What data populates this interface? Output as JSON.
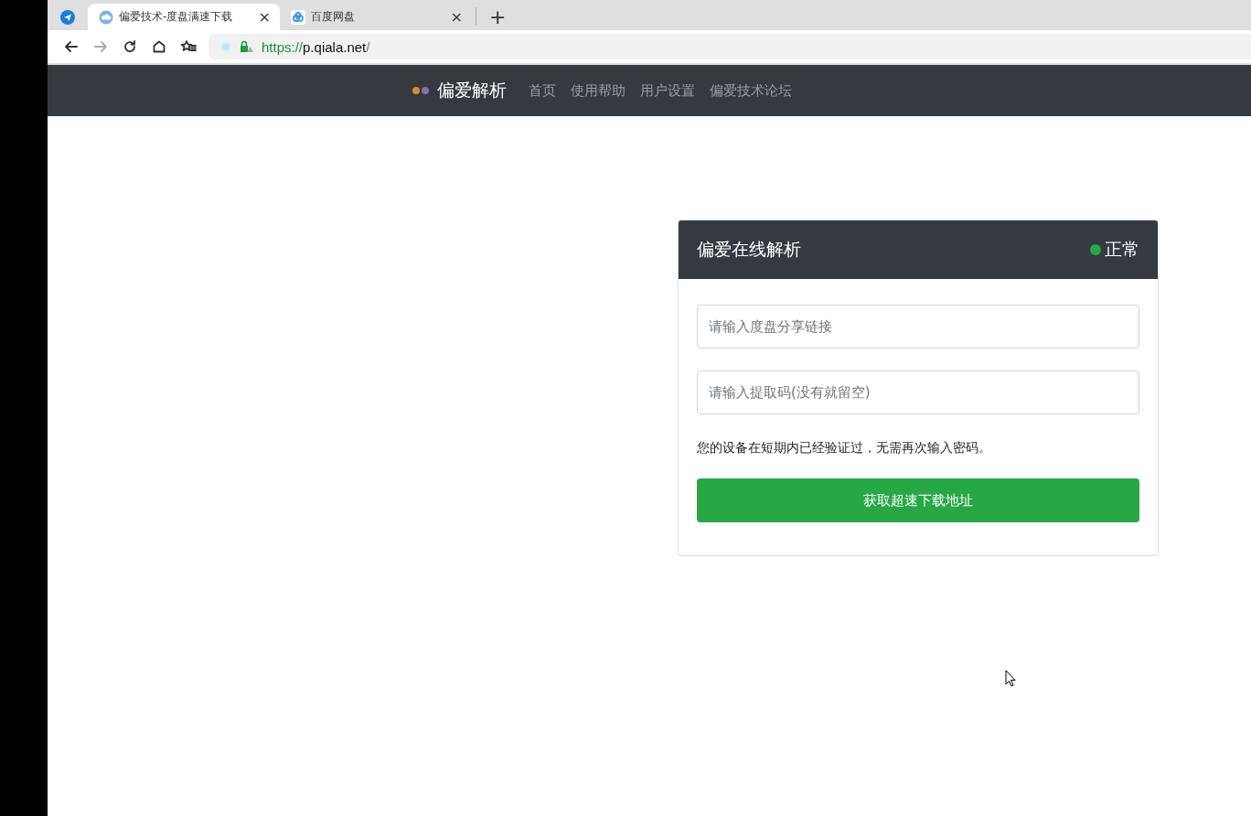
{
  "browser": {
    "tabs": [
      {
        "kind": "pinned",
        "selected": false
      },
      {
        "kind": "page",
        "title": "偏爱技术-度盘满速下载",
        "selected": true,
        "close": "×"
      },
      {
        "kind": "page",
        "title": "百度网盘",
        "selected": false,
        "close": "×"
      }
    ],
    "new_tab": "+",
    "address": {
      "scheme": "https://",
      "host": "p.qiala.net",
      "path": "/"
    }
  },
  "navbar": {
    "brand": "偏爱解析",
    "links": [
      {
        "label": "首页"
      },
      {
        "label": "使用帮助"
      },
      {
        "label": "用户设置"
      },
      {
        "label": "偏爱技术论坛"
      }
    ]
  },
  "card": {
    "title": "偏爱在线解析",
    "status": {
      "label": "正常",
      "color": "#28a745"
    },
    "fields": [
      {
        "placeholder": "请输入度盘分享链接"
      },
      {
        "placeholder": "请输入提取码(没有就留空)"
      }
    ],
    "note": "您的设备在短期内已经验证过，无需再次输入密码。",
    "button": "获取超速下载地址"
  }
}
